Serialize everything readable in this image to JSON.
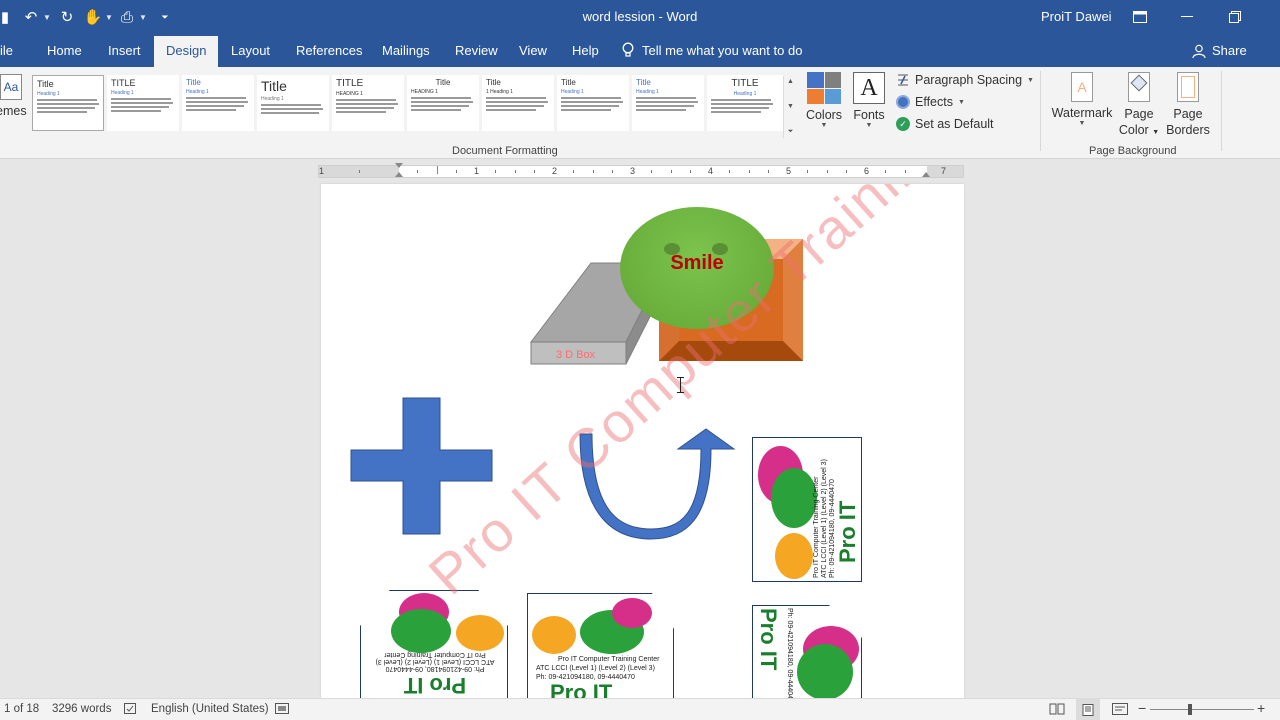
{
  "title_bar": {
    "title": "word lession  -  Word",
    "user": "ProiT Dawei"
  },
  "tabs": [
    {
      "label": "ile"
    },
    {
      "label": "Home"
    },
    {
      "label": "Insert"
    },
    {
      "label": "Design"
    },
    {
      "label": "Layout"
    },
    {
      "label": "References"
    },
    {
      "label": "Mailings"
    },
    {
      "label": "Review"
    },
    {
      "label": "View"
    },
    {
      "label": "Help"
    }
  ],
  "tell_me": "Tell me what you want to do",
  "share": "Share",
  "ribbon": {
    "themes_label": "emes",
    "style_thumbs": [
      {
        "title": "Title",
        "heading": "Heading 1"
      },
      {
        "title": "TITLE",
        "heading": "Heading 1"
      },
      {
        "title": "Title",
        "heading": "Heading 1"
      },
      {
        "title": "Title",
        "heading": "Heading 1"
      },
      {
        "title": "TITLE",
        "heading": "HEADING 1"
      },
      {
        "title": "Title",
        "heading": "HEADING 1"
      },
      {
        "title": "Title",
        "heading": "1  Heading 1"
      },
      {
        "title": "Title",
        "heading": "Heading 1"
      },
      {
        "title": "Title",
        "heading": "Heading 1"
      },
      {
        "title": "TITLE",
        "heading": "Heading 1"
      }
    ],
    "colors": "Colors",
    "fonts": "Fonts",
    "fonts_glyph": "A",
    "paragraph_spacing": "Paragraph Spacing",
    "effects": "Effects",
    "set_as_default": "Set as Default",
    "document_formatting": "Document Formatting",
    "watermark": "Watermark",
    "page_color_1": "Page",
    "page_color_2": "Color",
    "page_borders_1": "Page",
    "page_borders_2": "Borders",
    "page_background": "Page Background"
  },
  "ruler_numbers": [
    "1",
    "1",
    "2",
    "3",
    "4",
    "5",
    "6",
    "7"
  ],
  "document": {
    "watermark": "Pro IT Computer Training",
    "smile": "Smile",
    "box_label": "3 D Box",
    "logo_brand": "Pro IT",
    "logo_center": "Pro IT Computer Training Center",
    "logo_atc": "ATC LCCI (Level 1) (Level 2) (Level 3)",
    "logo_phone": "Ph: 09-421094180, 09-4440470"
  },
  "status": {
    "page": "1 of 18",
    "words": "3296 words",
    "language": "English (United States)"
  },
  "colors": {
    "ribbon_blue": "#2b579a",
    "shape_blue": "#4472c4",
    "orange": "#d86b21",
    "green": "#70ad47",
    "smile_text": "#c00000"
  }
}
